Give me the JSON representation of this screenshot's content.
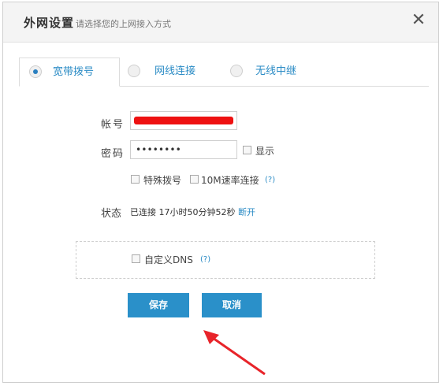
{
  "header": {
    "title": "外网设置",
    "subtitle": "请选择您的上网接入方式",
    "close_label": "✕"
  },
  "tabs": [
    {
      "label": "宽带拨号",
      "selected": true
    },
    {
      "label": "网线连接",
      "selected": false
    },
    {
      "label": "无线中继",
      "selected": false
    }
  ],
  "form": {
    "account_label": "帐号",
    "account_value": "",
    "password_label": "密码",
    "password_value": "••••••••",
    "show_label": "显示",
    "special_dial_label": "特殊拨号",
    "speed_label": "10M速率连接",
    "help_label": "(?)"
  },
  "status": {
    "label": "状态",
    "value": "已连接 17小时50分钟52秒",
    "disconnect_label": "断开"
  },
  "dns": {
    "label": "自定义DNS",
    "help_label": "(?)"
  },
  "buttons": {
    "save_label": "保存",
    "cancel_label": "取消"
  },
  "colors": {
    "accent": "#2a90c9",
    "link": "#2a8bc5",
    "arrow": "#e8242a",
    "redaction": "#ee1111"
  }
}
